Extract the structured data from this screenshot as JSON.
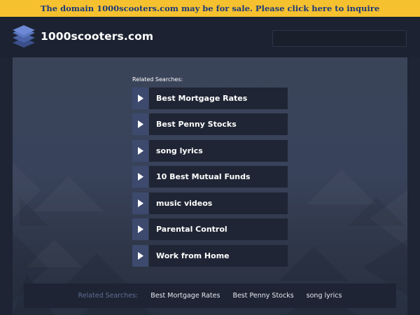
{
  "banner": {
    "text": "The domain 1000scooters.com may be for sale. Please click here to inquire"
  },
  "header": {
    "site_name": "1000scooters.com",
    "logo_icon": "stacked-layers-icon"
  },
  "related": {
    "label": "Related Searches:",
    "links": [
      {
        "label": "Best Mortgage Rates"
      },
      {
        "label": "Best Penny Stocks"
      },
      {
        "label": "song lyrics"
      },
      {
        "label": "10 Best Mutual Funds"
      },
      {
        "label": "music videos"
      },
      {
        "label": "Parental Control"
      },
      {
        "label": "Work from Home"
      }
    ]
  },
  "bottom": {
    "label": "Related Searches:",
    "links": [
      {
        "label": "Best Mortgage Rates"
      },
      {
        "label": "Best Penny Stocks"
      },
      {
        "label": "song lyrics"
      }
    ]
  },
  "colors": {
    "banner_bg": "#f6c12f",
    "banner_text": "#1d3a7a",
    "page_bg": "#1e2433",
    "arrow_bg": "#3d4a6e",
    "link_bg": "#1f2534"
  }
}
